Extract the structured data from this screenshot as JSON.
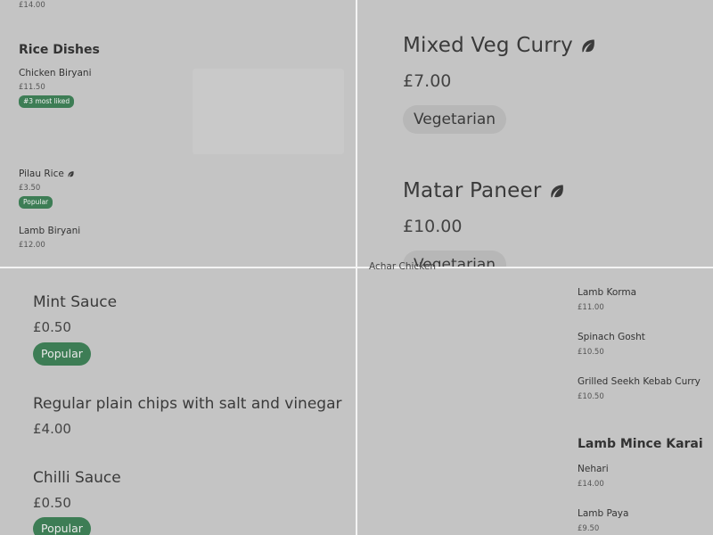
{
  "top_left": {
    "prev_price": "£14.00",
    "section_title": "Rice Dishes",
    "items": [
      {
        "name": "Chicken Biryani",
        "price": "£11.50",
        "badge": "#3 most liked"
      },
      {
        "name": "Pilau Rice",
        "price": "£3.50",
        "badge": "Popular"
      },
      {
        "name": "Lamb Biryani",
        "price": "£12.00"
      }
    ]
  },
  "top_right": {
    "items": [
      {
        "name": "Mixed Veg Curry",
        "price": "£7.00",
        "tag": "Vegetarian"
      },
      {
        "name": "Matar Paneer",
        "price": "£10.00",
        "tag": "Vegetarian"
      }
    ]
  },
  "bottom_left": {
    "items": [
      {
        "name": "Mint Sauce",
        "price": "£0.50",
        "badge": "Popular"
      },
      {
        "name": "Regular plain chips with salt and vinegar",
        "price": "£4.00"
      },
      {
        "name": "Chilli Sauce",
        "price": "£0.50",
        "badge": "Popular"
      }
    ]
  },
  "bottom_right": {
    "cut_item": "Achar Chicken",
    "items": [
      {
        "name": "Lamb Korma",
        "price": "£11.00"
      },
      {
        "name": "Spinach Gosht",
        "price": "£10.50"
      },
      {
        "name": "Grilled Seekh Kebab Curry",
        "price": "£10.50"
      }
    ],
    "section_title": "Lamb Mince Karai",
    "section_items": [
      {
        "name": "Nehari",
        "price": "£14.00"
      },
      {
        "name": "Lamb Paya",
        "price": "£9.50"
      }
    ]
  },
  "colors": {
    "background": "#c4c4c4",
    "badge_green": "#3d7d55",
    "divider": "#f4f4f4",
    "tag_bg": "#b7b7b7"
  },
  "icons": [
    "leaf-icon"
  ]
}
